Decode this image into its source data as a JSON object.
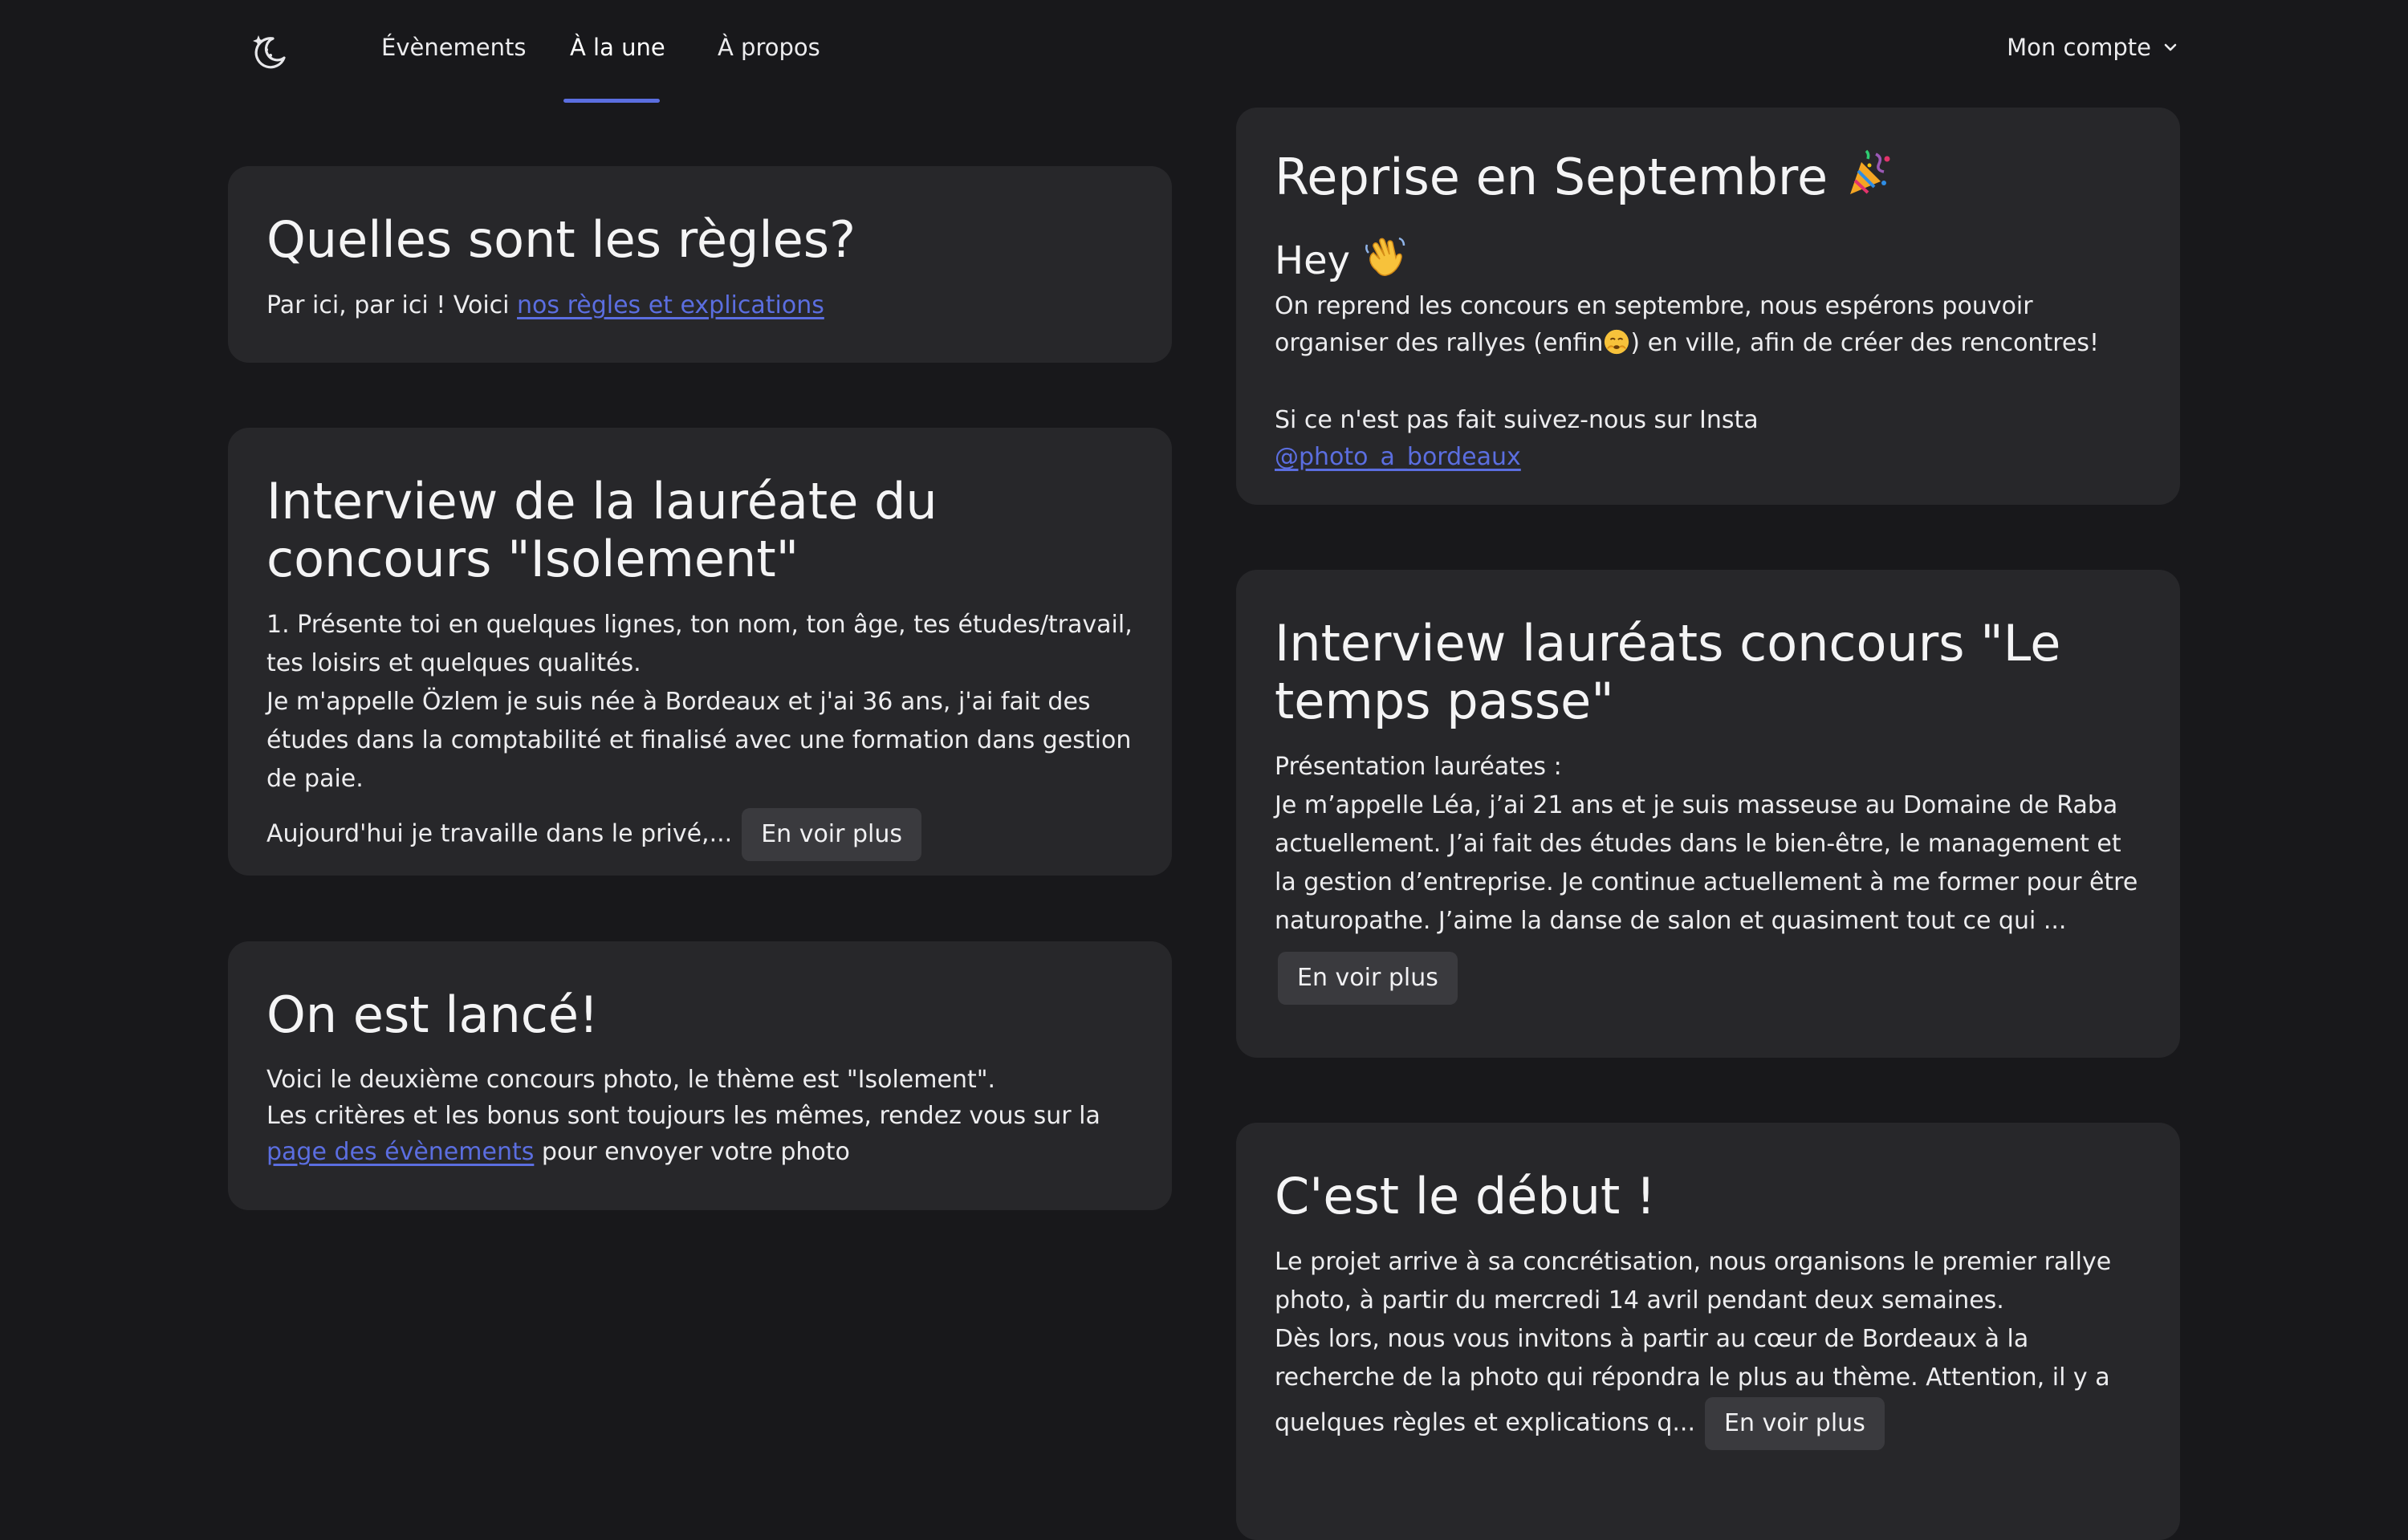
{
  "nav": {
    "logo": "moon-stars-icon",
    "items": [
      {
        "label": "Évènements"
      },
      {
        "label": "À la une"
      },
      {
        "label": "À propos"
      }
    ],
    "active_index": 1,
    "account_label": "Mon compte",
    "accent": "#5b6ee0"
  },
  "left": {
    "rules": {
      "title": "Quelles sont les règles?",
      "text": "Par ici, par ici ! Voici ",
      "link": "nos règles et explications"
    },
    "interview": {
      "title": "Interview de la lauréate du concours \"Isolement\"",
      "line1": "1. Présente toi en quelques lignes, ton nom, ton âge, tes études/travail, tes loisirs et quelques qualités.",
      "line2": "Je m'appelle Özlem je suis née à Bordeaux et j'ai 36 ans, j'ai fait des études dans la comptabilité et finalisé avec une formation dans gestion de paie.",
      "excerpt": "Aujourd'hui je travaille dans le privé,...",
      "more": "En voir plus"
    },
    "launched": {
      "title": "On est lancé!",
      "line1": "Voici le deuxième concours photo, le thème est \"Isolement\".",
      "line2": "Les critères et les bonus sont toujours les mêmes, rendez vous sur la ",
      "link": "page des évènements",
      "line2_end": " pour envoyer votre photo"
    }
  },
  "right": {
    "reprise": {
      "title": "Reprise en Septembre",
      "hey": "Hey",
      "text_a": "On reprend les concours en septembre, nous espérons pouvoir organiser des rallyes (enfin",
      "text_b": ") en ville, afin de créer des rencontres!",
      "text_c": "Si ce n'est pas fait suivez-nous sur Insta",
      "link": "@photo_a_bordeaux"
    },
    "interview": {
      "title": "Interview lauréats concours \"Le temps passe\"",
      "line1": "Présentation lauréates :",
      "line2": "Je m’appelle Léa, j’ai 21 ans et je suis masseuse au Domaine de Raba actuellement. J’ai fait des études dans le bien-être, le management et la gestion d’entreprise. Je continue actuellement à me former pour être naturopathe. J’aime la danse de salon et quasiment tout ce qui ...",
      "more": "En voir plus"
    },
    "debut": {
      "title": "C'est le début !",
      "line1": "Le projet arrive à sa concrétisation, nous organisons le premier rallye photo, à partir du mercredi 14 avril pendant deux semaines.",
      "line2": "Dès lors, nous vous invitons à partir au cœur de Bordeaux à la recherche de la photo qui répondra le plus au thème. Attention, il y a quelques règles et explications q...",
      "more": "En voir plus"
    }
  }
}
